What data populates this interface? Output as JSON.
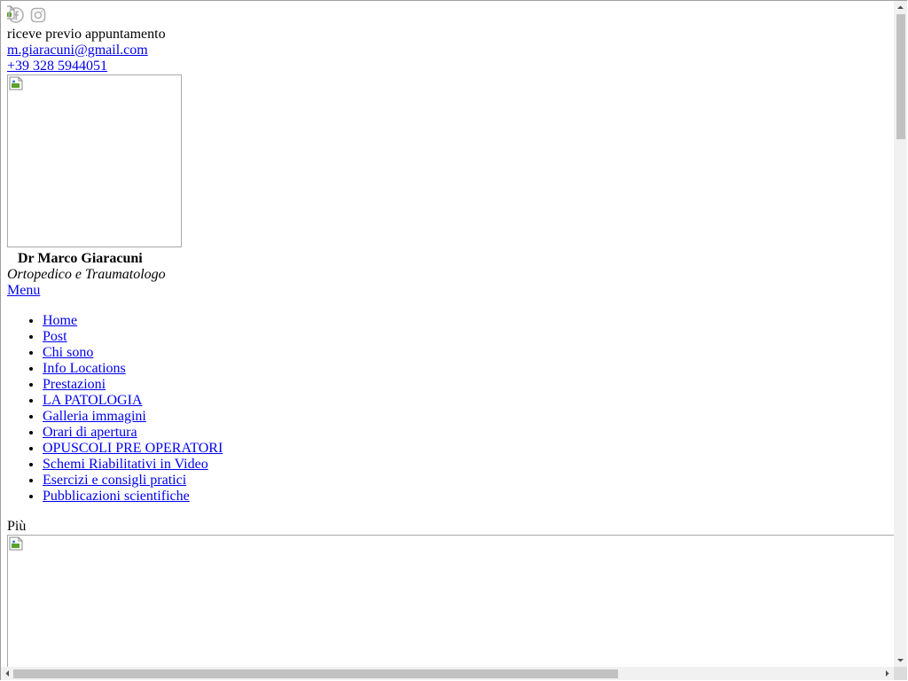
{
  "contact": {
    "note": "riceve previo appuntamento",
    "email": "m.giaracuni@gmail.com",
    "phone": "+39 328 5944051"
  },
  "profile": {
    "name": "Dr Marco Giaracuni",
    "role": "Ortopedico e Traumatologo"
  },
  "menu_label": "Menu",
  "nav": {
    "items": [
      {
        "label": "Home"
      },
      {
        "label": "Post"
      },
      {
        "label": "Chi sono"
      },
      {
        "label": "Info Locations"
      },
      {
        "label": "Prestazioni"
      },
      {
        "label": "LA PATOLOGIA"
      },
      {
        "label": "Galleria immagini"
      },
      {
        "label": "Orari di apertura"
      },
      {
        "label": "OPUSCOLI PRE OPERATORI"
      },
      {
        "label": "Schemi Riabilitativi in Video"
      },
      {
        "label": "Esercizi e consigli pratici"
      },
      {
        "label": "Pubblicazioni scientifiche"
      }
    ]
  },
  "more_label": "Più",
  "colors": {
    "link": "#0000ee",
    "text": "#000000",
    "icon_gray": "#b0b0b0",
    "scrollbar_track": "#f1f1f1",
    "scrollbar_thumb": "#c1c1c1"
  },
  "icons": {
    "social": [
      "facebook-icon",
      "instagram-icon"
    ],
    "placeholder": "broken-image-icon"
  }
}
